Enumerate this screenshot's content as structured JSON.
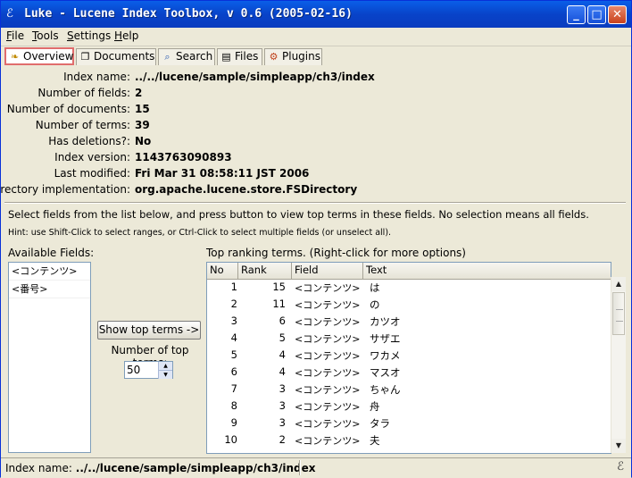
{
  "window": {
    "title": "Luke - Lucene Index Toolbox, v 0.6 (2005-02-16)",
    "icon": "luke-app-icon",
    "controls": {
      "minimize": "_",
      "maximize": "□",
      "close": "✕"
    }
  },
  "menu": {
    "items": [
      {
        "label": "File",
        "accel": "F",
        "rest": "ile"
      },
      {
        "label": "Tools",
        "accel": "T",
        "rest": "ools"
      },
      {
        "label": "Settings",
        "accel": "S",
        "rest": "ettings"
      },
      {
        "label": "Help",
        "accel": "H",
        "rest": "elp"
      }
    ]
  },
  "tabs": [
    {
      "label": "Overview",
      "icon": "overview-icon",
      "glyph": "❧",
      "active": true
    },
    {
      "label": "Documents",
      "icon": "documents-icon",
      "glyph": "❐",
      "active": false
    },
    {
      "label": "Search",
      "icon": "search-icon",
      "glyph": "⌕",
      "active": false
    },
    {
      "label": "Files",
      "icon": "files-icon",
      "glyph": "▤",
      "active": false
    },
    {
      "label": "Plugins",
      "icon": "plugins-icon",
      "glyph": "⚙",
      "active": false
    }
  ],
  "overview": {
    "index_name": {
      "label": "Index name:",
      "value": "../../lucene/sample/simpleapp/ch3/index"
    },
    "num_fields": {
      "label": "Number of fields:",
      "value": "2"
    },
    "num_docs": {
      "label": "Number of documents:",
      "value": "15"
    },
    "num_terms": {
      "label": "Number of terms:",
      "value": "39"
    },
    "has_deletions": {
      "label": "Has deletions?:",
      "value": "No"
    },
    "index_version": {
      "label": "Index version:",
      "value": "1143763090893"
    },
    "last_modified": {
      "label": "Last modified:",
      "value": "Fri Mar 31 08:58:11 JST 2006"
    },
    "dir_impl": {
      "label": "Directory implementation:",
      "value": "org.apache.lucene.store.FSDirectory"
    }
  },
  "instructions": "Select fields from the list below, and press button to view top terms in these fields. No selection means all fields.",
  "hint": "Hint: use Shift-Click to select ranges, or Ctrl-Click to select multiple fields (or unselect all).",
  "available_fields": {
    "label": "Available Fields:",
    "items": [
      "<コンテンツ>",
      "<番号>"
    ]
  },
  "show_top_button": "Show top terms ->",
  "num_top_terms": {
    "label": "Number of top terms:",
    "value": "50"
  },
  "top_terms": {
    "label": "Top ranking terms. (Right-click for more options)",
    "columns": [
      "No",
      "Rank",
      "Field",
      "Text"
    ],
    "rows": [
      {
        "no": "1",
        "rank": "15",
        "field": "<コンテンツ>",
        "text": "は"
      },
      {
        "no": "2",
        "rank": "11",
        "field": "<コンテンツ>",
        "text": "の"
      },
      {
        "no": "3",
        "rank": "6",
        "field": "<コンテンツ>",
        "text": "カツオ"
      },
      {
        "no": "4",
        "rank": "5",
        "field": "<コンテンツ>",
        "text": "サザエ"
      },
      {
        "no": "5",
        "rank": "4",
        "field": "<コンテンツ>",
        "text": "ワカメ"
      },
      {
        "no": "6",
        "rank": "4",
        "field": "<コンテンツ>",
        "text": "マスオ"
      },
      {
        "no": "7",
        "rank": "3",
        "field": "<コンテンツ>",
        "text": "ちゃん"
      },
      {
        "no": "8",
        "rank": "3",
        "field": "<コンテンツ>",
        "text": "舟"
      },
      {
        "no": "9",
        "rank": "3",
        "field": "<コンテンツ>",
        "text": "タラ"
      },
      {
        "no": "10",
        "rank": "2",
        "field": "<コンテンツ>",
        "text": "夫"
      }
    ]
  },
  "status": {
    "label": "Index name:",
    "value": "../../lucene/sample/simpleapp/ch3/index",
    "icon": "luke-status-icon"
  }
}
